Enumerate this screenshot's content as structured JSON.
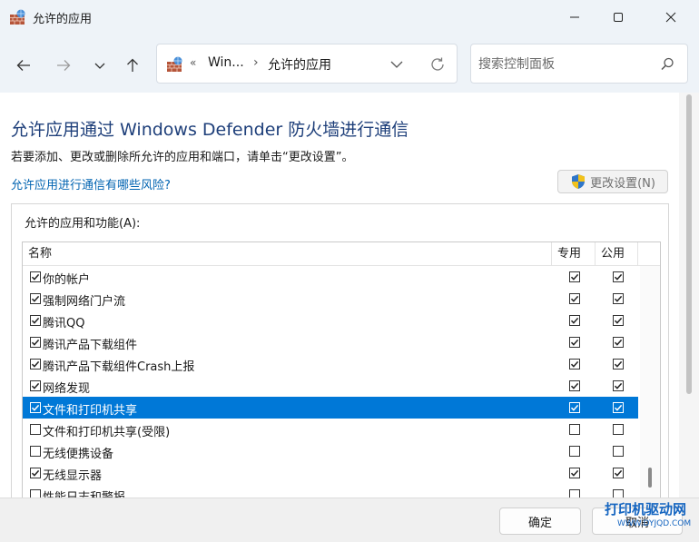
{
  "window": {
    "title": "允许的应用",
    "controls": [
      "minimize-icon",
      "maximize-icon",
      "close-icon"
    ]
  },
  "nav": {
    "breadcrumb_prefix": "«",
    "breadcrumb": [
      "Win...",
      "允许的应用"
    ],
    "breadcrumb_separator": "›",
    "search_placeholder": "搜索控制面板"
  },
  "main": {
    "heading": "允许应用通过 Windows Defender 防火墙进行通信",
    "description": "若要添加、更改或删除所允许的应用和端口，请单击“更改设置”。",
    "risk_link": "允许应用进行通信有哪些风险?",
    "change_settings_label": "更改设置(N)",
    "group_label": "允许的应用和功能(A):",
    "columns": {
      "name": "名称",
      "private": "专用",
      "public": "公用"
    },
    "rows": [
      {
        "name": "你的帐户",
        "enabled": true,
        "private": true,
        "public": true,
        "selected": false
      },
      {
        "name": "强制网络门户流",
        "enabled": true,
        "private": true,
        "public": true,
        "selected": false
      },
      {
        "name": "腾讯QQ",
        "enabled": true,
        "private": true,
        "public": true,
        "selected": false
      },
      {
        "name": "腾讯产品下载组件",
        "enabled": true,
        "private": true,
        "public": true,
        "selected": false
      },
      {
        "name": "腾讯产品下载组件Crash上报",
        "enabled": true,
        "private": true,
        "public": true,
        "selected": false
      },
      {
        "name": "网络发现",
        "enabled": true,
        "private": true,
        "public": true,
        "selected": false
      },
      {
        "name": "文件和打印机共享",
        "enabled": true,
        "private": true,
        "public": true,
        "selected": true
      },
      {
        "name": "文件和打印机共享(受限)",
        "enabled": false,
        "private": false,
        "public": false,
        "selected": false
      },
      {
        "name": "无线便携设备",
        "enabled": false,
        "private": false,
        "public": false,
        "selected": false
      },
      {
        "name": "无线显示器",
        "enabled": true,
        "private": true,
        "public": true,
        "selected": false
      },
      {
        "name": "性能日志和警报",
        "enabled": false,
        "private": false,
        "public": false,
        "selected": false
      }
    ]
  },
  "footer": {
    "ok_label": "确定",
    "cancel_label": "取消"
  },
  "watermark": {
    "main": "打印机驱动网",
    "sub": "WWW.DYJQD.COM"
  },
  "colors": {
    "accent": "#0078d7",
    "heading": "#1e3f7a",
    "link": "#0063b1",
    "titlebar": "#eef3f8",
    "watermark": "#1565c0"
  }
}
